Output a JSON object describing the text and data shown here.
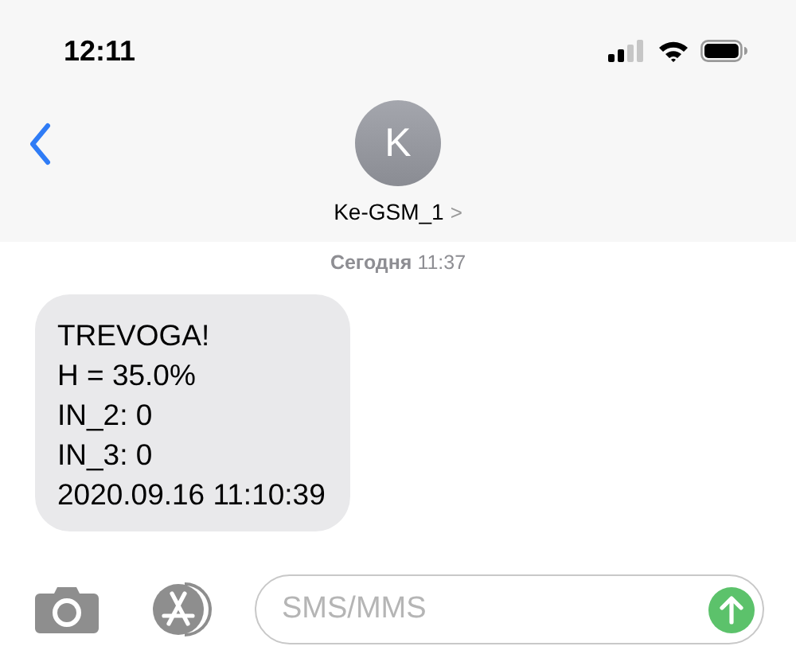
{
  "status_bar": {
    "time": "12:11"
  },
  "header": {
    "avatar_initial": "K",
    "contact_name": "Ke-GSM_1",
    "contact_chevron": ">"
  },
  "timestamp": "**Сегодня** 11:37",
  "messages": [
    {
      "kind": "incoming",
      "text": "TREVOGA!\nH = 35.0%\nIN_2: 0\nIN_3: 0\n2020.09.16 11:10:39"
    }
  ],
  "composer": {
    "placeholder": "SMS/MMS"
  }
}
